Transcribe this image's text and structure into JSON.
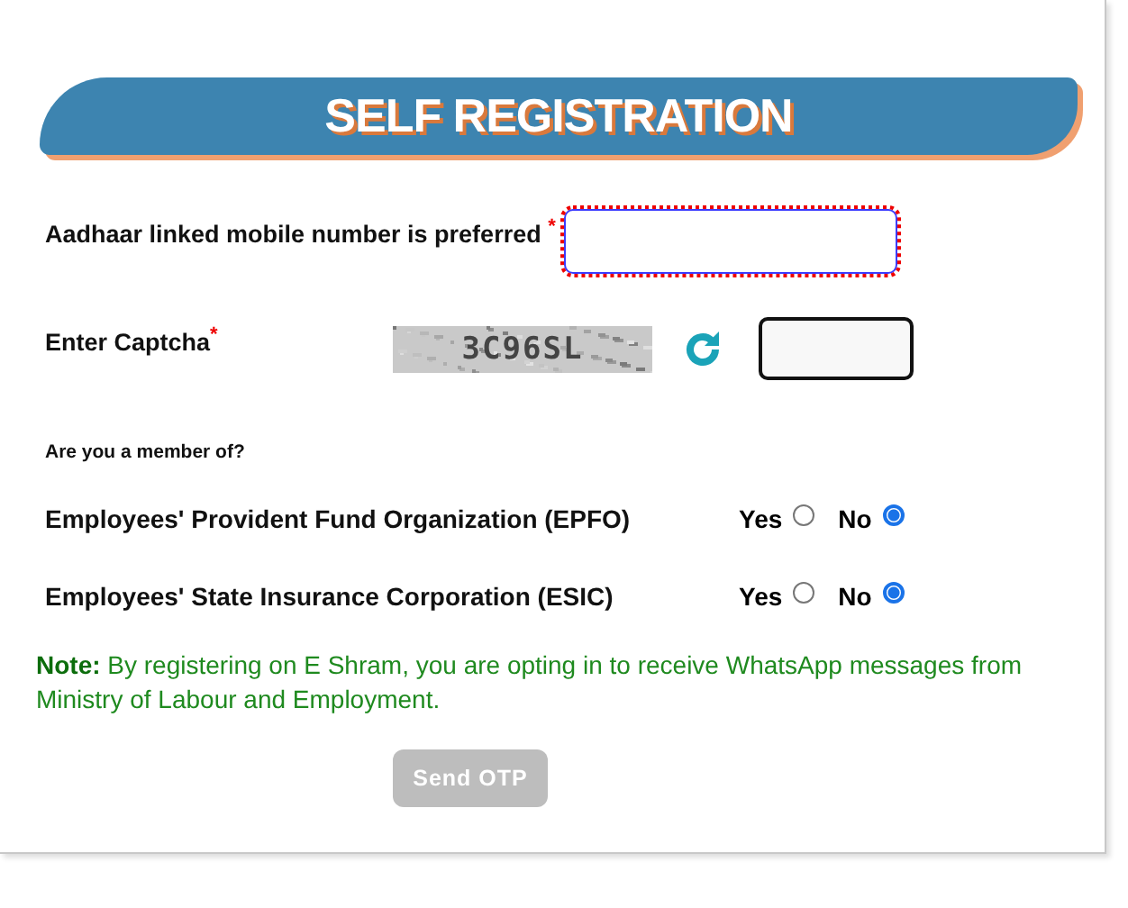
{
  "title": "SELF REGISTRATION",
  "mobile": {
    "label": "Aadhaar linked mobile number is preferred",
    "required_mark": "*",
    "error": true
  },
  "captcha": {
    "label": "Enter Captcha",
    "required_mark": "*",
    "code": "3C96SL"
  },
  "membership": {
    "question": "Are you a member of?",
    "items": [
      {
        "label": "Employees' Provident Fund Organization (EPFO)",
        "options": [
          {
            "label": "Yes",
            "selected": false
          },
          {
            "label": "No",
            "selected": true
          }
        ]
      },
      {
        "label": "Employees' State Insurance Corporation (ESIC)",
        "options": [
          {
            "label": "Yes",
            "selected": false
          },
          {
            "label": "No",
            "selected": true
          }
        ]
      }
    ]
  },
  "note": "**Note:** By registering on E Shram, you are opting in to receive WhatsApp messages from Ministry of Labour and Employment.",
  "button": {
    "label": "Send OTP",
    "disabled": true
  }
}
